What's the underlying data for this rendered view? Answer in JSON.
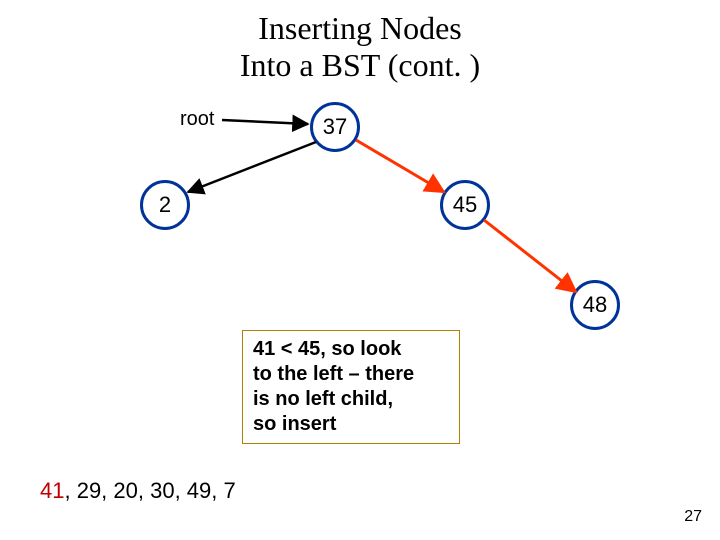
{
  "title_line1": "Inserting Nodes",
  "title_line2": "Into a BST (cont. )",
  "root_label": "root",
  "nodes": {
    "n37": "37",
    "n2": "2",
    "n45": "45",
    "n48": "48"
  },
  "note_l1": "41 < 45, so look",
  "note_l2": "to the left – there",
  "note_l3": "is no left child,",
  "note_l4": "so insert",
  "seq_hl": "41",
  "seq_rest": ", 29, 20, 30, 49, 7",
  "slide_number": "27",
  "colors": {
    "node_border": "#003399",
    "edge_normal": "#000000",
    "edge_highlight": "#ff3300",
    "note_border": "#b08000",
    "seq_hl": "#c00000"
  }
}
